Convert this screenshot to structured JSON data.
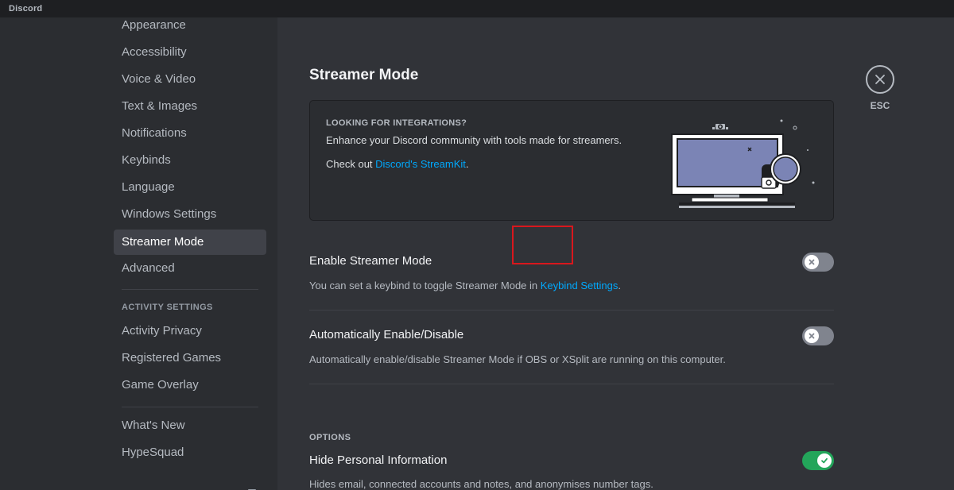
{
  "app": {
    "title": "Discord"
  },
  "sidebar": {
    "items_top": [
      {
        "label": "Appearance"
      },
      {
        "label": "Accessibility"
      },
      {
        "label": "Voice & Video"
      },
      {
        "label": "Text & Images"
      },
      {
        "label": "Notifications"
      },
      {
        "label": "Keybinds"
      },
      {
        "label": "Language"
      },
      {
        "label": "Windows Settings"
      },
      {
        "label": "Streamer Mode",
        "selected": true
      },
      {
        "label": "Advanced"
      }
    ],
    "activity_header": "ACTIVITY SETTINGS",
    "activity_items": [
      {
        "label": "Activity Privacy"
      },
      {
        "label": "Registered Games"
      },
      {
        "label": "Game Overlay"
      }
    ],
    "misc_items": [
      {
        "label": "What's New"
      },
      {
        "label": "HypeSquad"
      }
    ]
  },
  "main": {
    "title": "Streamer Mode",
    "close_label": "ESC",
    "integration_card": {
      "heading": "LOOKING FOR INTEGRATIONS?",
      "text": "Enhance your Discord community with tools made for streamers.",
      "link_prefix": "Check out ",
      "link_text": "Discord's StreamKit",
      "link_suffix": "."
    },
    "settings": [
      {
        "title": "Enable Streamer Mode",
        "desc_prefix": "You can set a keybind to toggle Streamer Mode in ",
        "desc_link": "Keybind Settings",
        "desc_suffix": ".",
        "enabled": false
      },
      {
        "title": "Automatically Enable/Disable",
        "desc": "Automatically enable/disable Streamer Mode if OBS or XSplit are running on this computer.",
        "enabled": false
      }
    ],
    "options_header": "OPTIONS",
    "options": [
      {
        "title": "Hide Personal Information",
        "desc": "Hides email, connected accounts and notes, and anonymises number tags.",
        "enabled": true
      }
    ]
  },
  "colors": {
    "accent_link": "#00a8fc",
    "toggle_on": "#23a55a",
    "toggle_off": "#80848e",
    "highlight": "#d9171d"
  }
}
